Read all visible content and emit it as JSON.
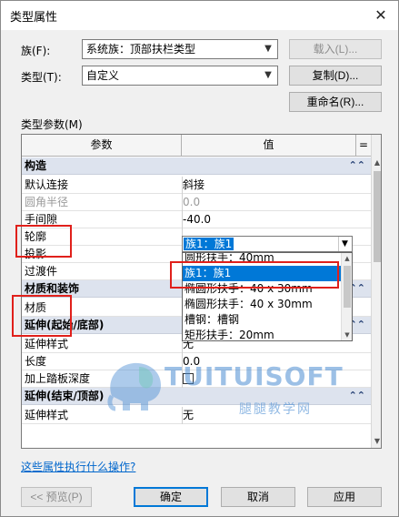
{
  "dialog": {
    "title": "类型属性",
    "close_glyph": "✕"
  },
  "family": {
    "label": "族(F):",
    "value": "系统族：顶部扶栏类型"
  },
  "type": {
    "label": "类型(T):",
    "value": "自定义"
  },
  "buttons": {
    "load": "载入(L)...",
    "duplicate": "复制(D)...",
    "rename": "重命名(R)..."
  },
  "type_params_label": "类型参数(M)",
  "grid": {
    "headers": {
      "param": "参数",
      "value": "值",
      "extra": "="
    },
    "rows": [
      {
        "kind": "group",
        "name": "构造",
        "collapse": "⌃⌃"
      },
      {
        "kind": "row",
        "name": "默认连接",
        "value": "斜接"
      },
      {
        "kind": "row",
        "name": "圆角半径",
        "value": "0.0",
        "dim": true
      },
      {
        "kind": "row",
        "name": "手间隙",
        "value": "-40.0"
      },
      {
        "kind": "row",
        "name": "轮廓",
        "value": ""
      },
      {
        "kind": "row",
        "name": "投影",
        "value": ""
      },
      {
        "kind": "row",
        "name": "过渡件",
        "value": ""
      },
      {
        "kind": "group",
        "name": "材质和装饰",
        "collapse": "⌃⌃"
      },
      {
        "kind": "row",
        "name": "材质",
        "value": ""
      },
      {
        "kind": "group",
        "name": "延伸(起始/底部)",
        "collapse": "⌃⌃"
      },
      {
        "kind": "row",
        "name": "延伸样式",
        "value": "无"
      },
      {
        "kind": "row",
        "name": "长度",
        "value": "0.0"
      },
      {
        "kind": "row",
        "name": "加上踏板深度",
        "value": "",
        "checkbox": true
      },
      {
        "kind": "group",
        "name": "延伸(结束/顶部)",
        "collapse": "⌃⌃"
      },
      {
        "kind": "row",
        "name": "延伸样式",
        "value": "无"
      }
    ]
  },
  "dropdown": {
    "selected": "族1：族1",
    "options": [
      "圆形扶手：40mm",
      "族1：族1",
      "椭圆形扶手：40 x 30mm",
      "椭圆形扶手：40 x 30mm",
      "槽钢：槽钢",
      "矩形扶手：20mm"
    ],
    "active_index": 1
  },
  "watermark": {
    "brand": "TUITUISOFT",
    "tagline": "腿腿教学网"
  },
  "help_link": "这些属性执行什么操作?",
  "footer": {
    "preview": "<< 预览(P)",
    "ok": "确定",
    "cancel": "取消",
    "apply": "应用"
  },
  "colors": {
    "selection": "#0078d7",
    "annotation": "#e0201b",
    "group_bg": "#dde3ee",
    "link": "#0066cc"
  },
  "icons": {
    "close": "close-icon",
    "arrow": "chevron-down-icon",
    "collapse": "collapse-icon",
    "watermark": "elephant-logo-icon"
  }
}
